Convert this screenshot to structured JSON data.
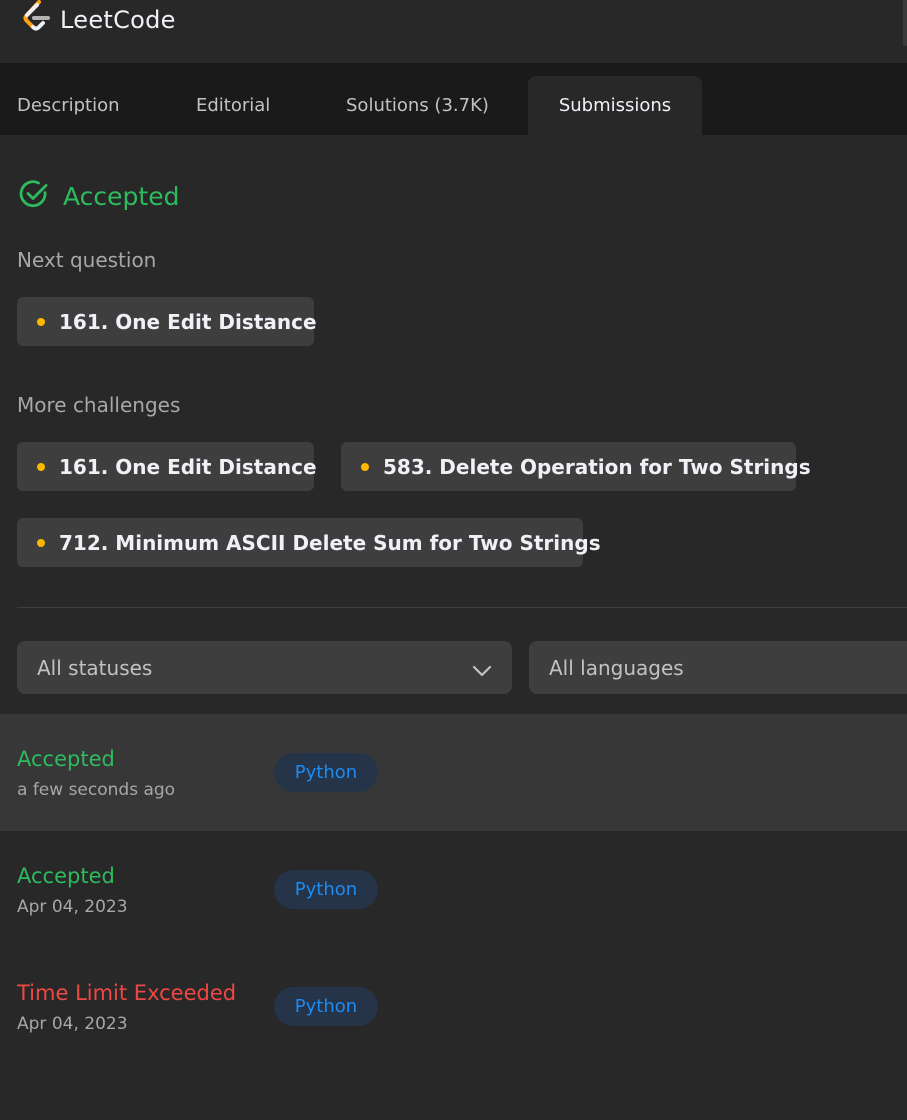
{
  "header": {
    "brand": "LeetCode",
    "logo_icon": "leetcode-logo-icon"
  },
  "tabs": [
    {
      "label": "Description",
      "active": false
    },
    {
      "label": "Editorial",
      "active": false
    },
    {
      "label": "Solutions (3.7K)",
      "active": false
    },
    {
      "label": "Submissions",
      "active": true
    }
  ],
  "result": {
    "status": "Accepted",
    "icon": "check-circle-icon",
    "color": "#2cbb5d"
  },
  "next_question": {
    "label": "Next question",
    "items": [
      {
        "title": "161. One Edit Distance",
        "difficulty_color": "#ffb800"
      }
    ]
  },
  "more_challenges": {
    "label": "More challenges",
    "items": [
      {
        "title": "161. One Edit Distance",
        "difficulty_color": "#ffb800"
      },
      {
        "title": "583. Delete Operation for Two Strings",
        "difficulty_color": "#ffb800"
      },
      {
        "title": "712. Minimum ASCII Delete Sum for Two Strings",
        "difficulty_color": "#ffb800"
      }
    ]
  },
  "filters": {
    "status": "All statuses",
    "language": "All languages"
  },
  "submissions": [
    {
      "status": "Accepted",
      "time": "a few seconds ago",
      "language": "Python",
      "status_color": "#2cbb5d"
    },
    {
      "status": "Accepted",
      "time": "Apr 04, 2023",
      "language": "Python",
      "status_color": "#2cbb5d"
    },
    {
      "status": "Time Limit Exceeded",
      "time": "Apr 04, 2023",
      "language": "Python",
      "status_color": "#ef4743"
    }
  ]
}
